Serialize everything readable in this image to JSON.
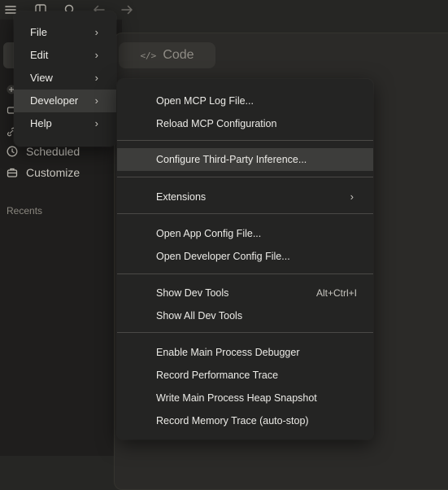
{
  "app": {
    "code_tab_label": "Code",
    "sidebar_items": [
      {
        "label": "Scheduled",
        "icon": "clock-icon"
      },
      {
        "label": "Customize",
        "icon": "briefcase-icon"
      }
    ],
    "recents_label": "Recents"
  },
  "menu": {
    "items": [
      {
        "label": "File",
        "icon": "chevron-right-icon"
      },
      {
        "label": "Edit",
        "icon": "chevron-right-icon"
      },
      {
        "label": "View",
        "icon": "chevron-right-icon"
      },
      {
        "label": "Developer",
        "icon": "chevron-right-icon",
        "active": true
      },
      {
        "label": "Help",
        "icon": "chevron-right-icon"
      }
    ]
  },
  "developer_menu": {
    "groups": [
      [
        {
          "label": "Open MCP Log File..."
        },
        {
          "label": "Reload MCP Configuration"
        }
      ],
      [
        {
          "label": "Configure Third-Party Inference...",
          "highlighted": true
        }
      ],
      [
        {
          "label": "Extensions",
          "submenu": true
        }
      ],
      [
        {
          "label": "Open App Config File..."
        },
        {
          "label": "Open Developer Config File..."
        }
      ],
      [
        {
          "label": "Show Dev Tools",
          "shortcut": "Alt+Ctrl+I"
        },
        {
          "label": "Show All Dev Tools"
        }
      ],
      [
        {
          "label": "Enable Main Process Debugger"
        },
        {
          "label": "Record Performance Trace"
        },
        {
          "label": "Write Main Process Heap Snapshot"
        },
        {
          "label": "Record Memory Trace (auto-stop)"
        }
      ]
    ]
  },
  "colors": {
    "menu_bg": "#242423",
    "highlight": "#3d3d3b",
    "app_bg": "#262624"
  }
}
